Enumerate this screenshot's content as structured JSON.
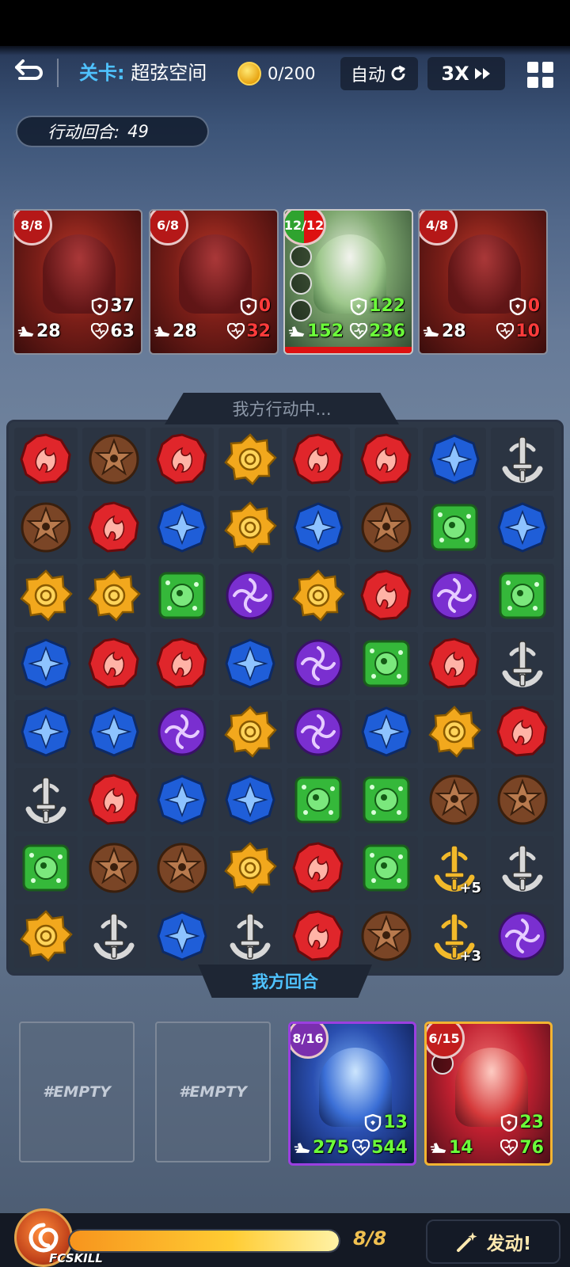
{
  "topbar": {
    "stage_label": "关卡:",
    "stage_name": "超弦空间",
    "currency": "0/200",
    "auto_label": "自动",
    "speed_label": "3X"
  },
  "turn": {
    "label": "行动回合:",
    "value": "49"
  },
  "enemies": [
    {
      "badge": "8/8",
      "speed": "28",
      "defense": "37",
      "hp": "63",
      "defense_color": "white",
      "hp_color": "white"
    },
    {
      "badge": "6/8",
      "speed": "28",
      "defense": "0",
      "hp": "32",
      "defense_color": "red",
      "hp_color": "red"
    },
    {
      "badge": "12/12",
      "speed": "152",
      "defense": "122",
      "hp": "236",
      "defense_color": "green",
      "hp_color": "green"
    },
    {
      "badge": "4/8",
      "speed": "28",
      "defense": "0",
      "hp": "10",
      "defense_color": "red",
      "hp_color": "red"
    }
  ],
  "board": {
    "header": "我方行动中...",
    "footer": "我方回合",
    "rows": [
      [
        "red",
        "brown",
        "red",
        "yellow",
        "red",
        "red",
        "blue",
        "sword"
      ],
      [
        "brown",
        "red",
        "blue",
        "yellow",
        "blue",
        "brown",
        "green",
        "blue"
      ],
      [
        "yellow",
        "yellow",
        "green",
        "purple",
        "yellow",
        "red",
        "purple",
        "green"
      ],
      [
        "blue",
        "red",
        "red",
        "blue",
        "purple",
        "green",
        "red",
        "sword"
      ],
      [
        "blue",
        "blue",
        "purple",
        "yellow",
        "purple",
        "blue",
        "yellow",
        "red"
      ],
      [
        "sword",
        "red",
        "blue",
        "blue",
        "green",
        "green",
        "brown",
        "brown"
      ],
      [
        "green",
        "brown",
        "brown",
        "yellow",
        "red",
        "green",
        "gold-sword",
        "sword"
      ],
      [
        "yellow",
        "sword",
        "blue",
        "sword",
        "red",
        "brown",
        "gold-sword",
        "purple"
      ]
    ],
    "bonuses": {
      "6-6": "+5",
      "7-6": "+3"
    }
  },
  "party": {
    "empty_label": "#EMPTY",
    "allies": [
      {
        "badge": "8/16",
        "defense": "13",
        "speed": "275",
        "hp": "544"
      },
      {
        "badge": "6/15",
        "defense": "23",
        "speed": "14",
        "hp": "76"
      }
    ]
  },
  "skill_bar": {
    "label": "FCSKILL",
    "energy": "8/8",
    "energy_fraction": 1.0,
    "launch_label": "发动!"
  },
  "colors": {
    "red": "#e0262b",
    "brown": "#7a4526",
    "yellow": "#f2a81d",
    "blue": "#1f5ed8",
    "green": "#35b83a",
    "purple": "#7a2fd0",
    "sword": "#d8d8d8",
    "gold-sword": "#f2b92a",
    "accent": "#4fc3ff"
  }
}
